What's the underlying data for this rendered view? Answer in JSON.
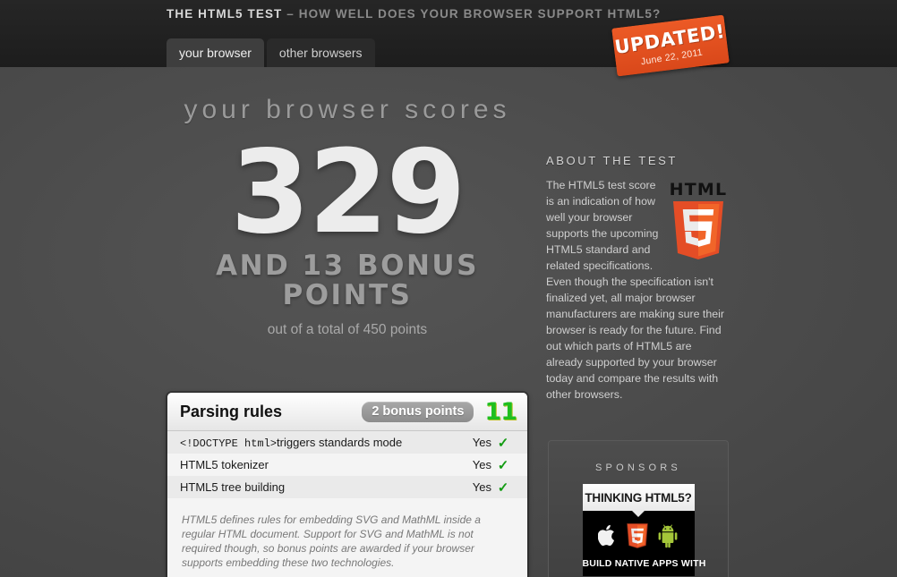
{
  "header": {
    "title_strong": "THE HTML5 TEST",
    "title_tagline": "– HOW WELL DOES YOUR BROWSER SUPPORT HTML5?",
    "tabs": [
      {
        "label": "your browser",
        "active": true
      },
      {
        "label": "other browsers",
        "active": false
      }
    ],
    "stamp": {
      "label": "UPDATED!",
      "date": "June 22, 2011",
      "color": "#e8521f"
    }
  },
  "score": {
    "heading": "your browser scores",
    "points": "329",
    "bonus_line": "AND 13 BONUS POINTS",
    "bonus_points": "13",
    "total_line": "out of a total of 450 points",
    "total_points": "450"
  },
  "card": {
    "title": "Parsing rules",
    "bonus_badge": "2 bonus points",
    "score": "11",
    "score_color": "#1fbf1f",
    "rows": [
      {
        "label_code": "<!DOCTYPE html>",
        "label_rest": "triggers standards mode",
        "value": "Yes",
        "check": "✓",
        "supported": true
      },
      {
        "label_code": "",
        "label_rest": "HTML5 tokenizer",
        "value": "Yes",
        "check": "✓",
        "supported": true
      },
      {
        "label_code": "",
        "label_rest": "HTML5 tree building",
        "value": "Yes",
        "check": "✓",
        "supported": true
      }
    ],
    "note": "HTML5 defines rules for embedding SVG and MathML inside a regular HTML document. Support for SVG and MathML is not required though, so bonus points are awarded if your browser supports embedding these two technologies."
  },
  "about": {
    "heading": "About the test",
    "body": "The HTML5 test score is an indication of how well your browser supports the upcoming HTML5 standard and related specifications. Even though the specification isn't finalized yet, all major browser manufacturers are making sure their browser is ready for the future. Find out which parts of HTML5 are already supported by your browser today and compare the results with other browsers.",
    "logo_wordmark": "HTML",
    "logo_digit": "5",
    "logo_colors": {
      "dark": "#e44d26",
      "light": "#f16529",
      "digit": "#ffffff"
    }
  },
  "sponsors": {
    "heading": "Sponsors",
    "ad": {
      "headline": "THINKING HTML5?",
      "tagline": "BUILD NATIVE APPS WITH",
      "logos": [
        "apple-logo",
        "html5-logo",
        "android-logo"
      ]
    }
  }
}
